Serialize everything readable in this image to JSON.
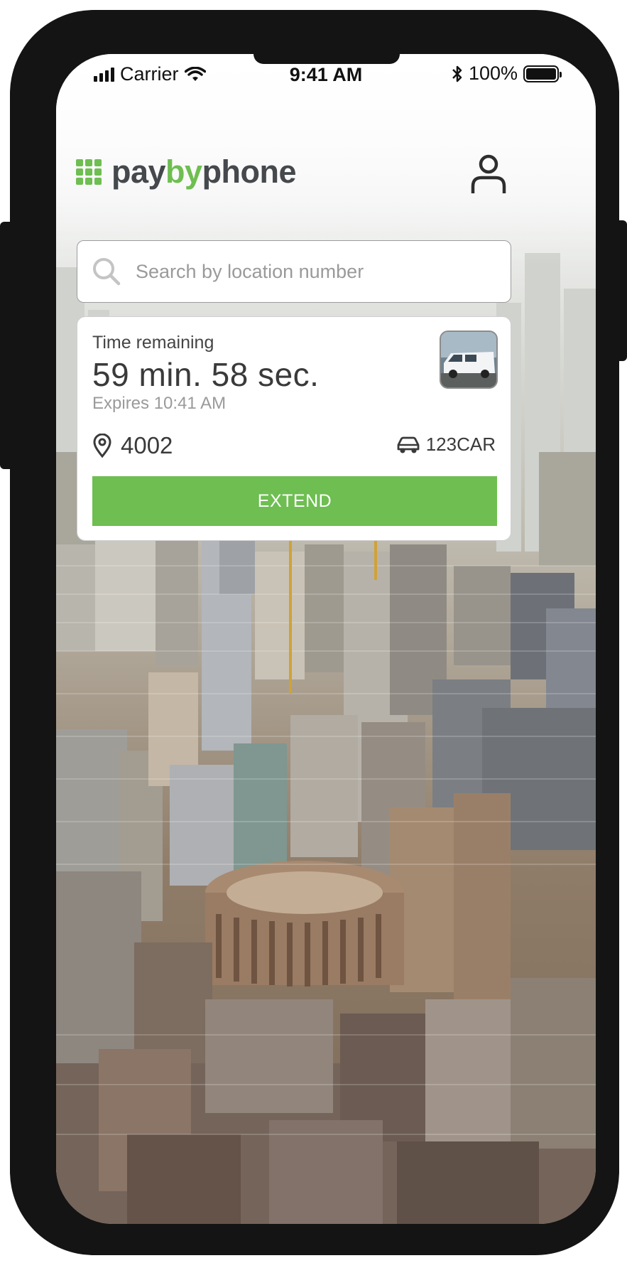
{
  "status_bar": {
    "carrier": "Carrier",
    "time": "9:41 AM",
    "battery": "100%",
    "battery_level": 1.0
  },
  "header": {
    "logo_pay": "pay",
    "logo_by": "by",
    "logo_phone": "phone",
    "brand_color": "#6ebe51",
    "profile_icon": "user-icon"
  },
  "search": {
    "placeholder": "Search by location number",
    "value": ""
  },
  "session": {
    "time_label": "Time remaining",
    "time_value": "59 min. 58 sec.",
    "expires": "Expires 10:41 AM",
    "location": "4002",
    "plate": "123CAR",
    "extend_label": "EXTEND",
    "vehicle_thumbnail": "white-van"
  }
}
